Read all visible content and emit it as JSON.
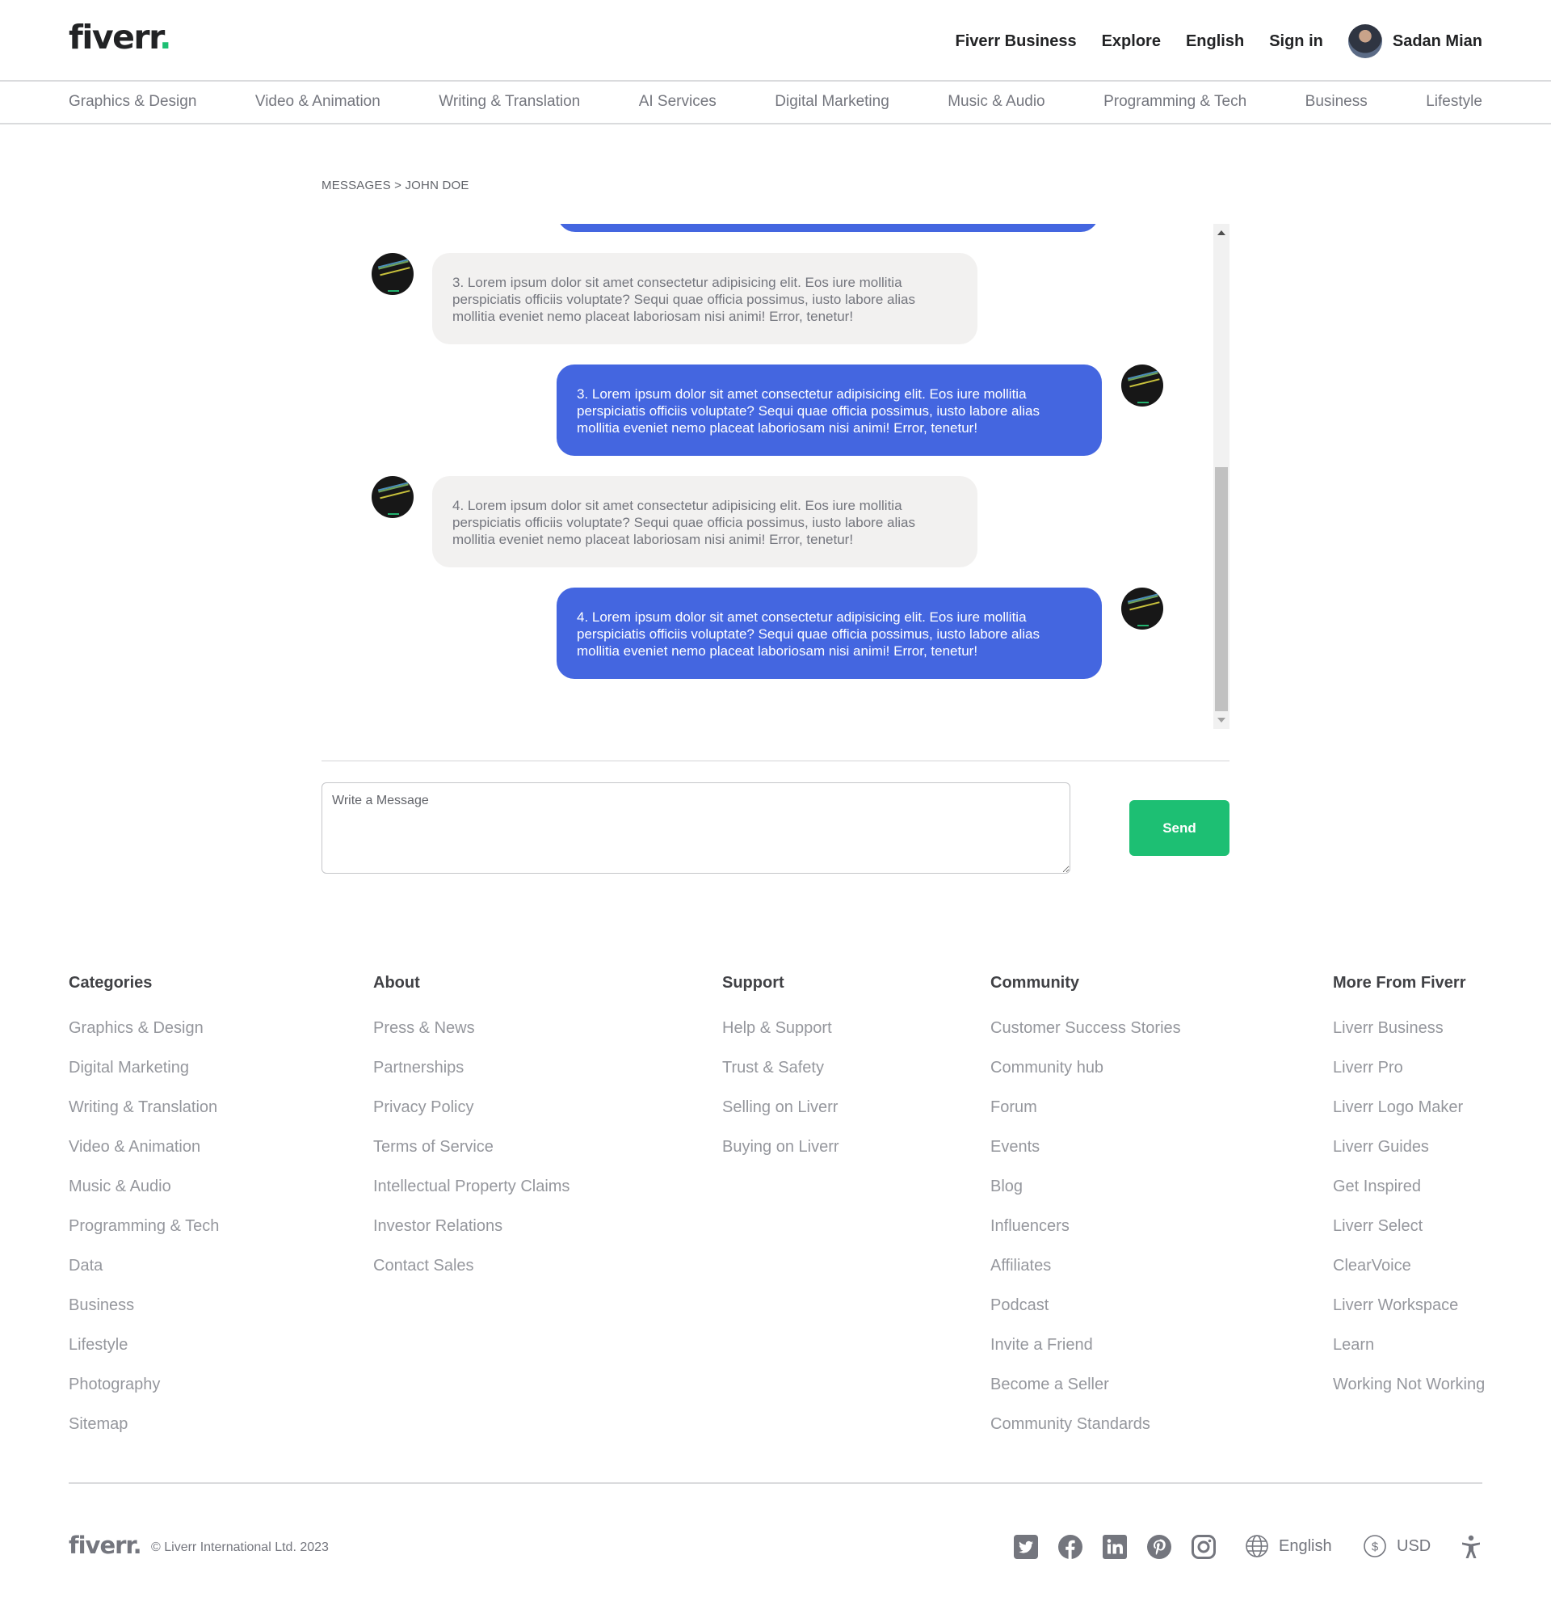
{
  "header": {
    "logo": "fiverr",
    "logo_dot": ".",
    "nav": {
      "business": "Fiverr Business",
      "explore": "Explore",
      "language": "English",
      "signin": "Sign in",
      "user_name": "Sadan Mian"
    }
  },
  "categories": [
    "Graphics & Design",
    "Video & Animation",
    "Writing & Translation",
    "AI Services",
    "Digital Marketing",
    "Music & Audio",
    "Programming & Tech",
    "Business",
    "Lifestyle"
  ],
  "breadcrumb": "MESSAGES > JOHN DOE",
  "messages": [
    {
      "direction": "incoming",
      "text": "3. Lorem ipsum dolor sit amet consectetur adipisicing elit. Eos iure mollitia perspiciatis officiis voluptate? Sequi quae officia possimus, iusto labore alias mollitia eveniet nemo placeat laboriosam nisi animi! Error, tenetur!"
    },
    {
      "direction": "outgoing",
      "text": "3. Lorem ipsum dolor sit amet consectetur adipisicing elit. Eos iure mollitia perspiciatis officiis voluptate? Sequi quae officia possimus, iusto labore alias mollitia eveniet nemo placeat laboriosam nisi animi! Error, tenetur!"
    },
    {
      "direction": "incoming",
      "text": "4. Lorem ipsum dolor sit amet consectetur adipisicing elit. Eos iure mollitia perspiciatis officiis voluptate? Sequi quae officia possimus, iusto labore alias mollitia eveniet nemo placeat laboriosam nisi animi! Error, tenetur!"
    },
    {
      "direction": "outgoing",
      "text": "4. Lorem ipsum dolor sit amet consectetur adipisicing elit. Eos iure mollitia perspiciatis officiis voluptate? Sequi quae officia possimus, iusto labore alias mollitia eveniet nemo placeat laboriosam nisi animi! Error, tenetur!"
    }
  ],
  "composer": {
    "placeholder": "Write a Message",
    "value": "",
    "send_label": "Send"
  },
  "footer": {
    "columns": [
      {
        "title": "Categories",
        "links": [
          "Graphics & Design",
          "Digital Marketing",
          "Writing & Translation",
          "Video & Animation",
          "Music & Audio",
          "Programming & Tech",
          "Data",
          "Business",
          "Lifestyle",
          "Photography",
          "Sitemap"
        ]
      },
      {
        "title": "About",
        "links": [
          "Press & News",
          "Partnerships",
          "Privacy Policy",
          "Terms of Service",
          "Intellectual Property Claims",
          "Investor Relations",
          "Contact Sales"
        ]
      },
      {
        "title": "Support",
        "links": [
          "Help & Support",
          "Trust & Safety",
          "Selling on Liverr",
          "Buying on Liverr"
        ]
      },
      {
        "title": "Community",
        "links": [
          "Customer Success Stories",
          "Community hub",
          "Forum",
          "Events",
          "Blog",
          "Influencers",
          "Affiliates",
          "Podcast",
          "Invite a Friend",
          "Become a Seller",
          "Community Standards"
        ]
      },
      {
        "title": "More From Fiverr",
        "links": [
          "Liverr Business",
          "Liverr Pro",
          "Liverr Logo Maker",
          "Liverr Guides",
          "Get Inspired",
          "Liverr Select",
          "ClearVoice",
          "Liverr Workspace",
          "Learn",
          "Working Not Working"
        ]
      }
    ],
    "logo": "fiverr.",
    "copyright": "© Liverr International Ltd. 2023",
    "social_icons": [
      "twitter-icon",
      "facebook-icon",
      "linkedin-icon",
      "pinterest-icon",
      "instagram-icon"
    ],
    "language": "English",
    "currency": "USD"
  },
  "colors": {
    "brand_green": "#1dbf73",
    "outgoing_bubble": "#4466e0",
    "incoming_bubble": "#f2f1f0"
  }
}
